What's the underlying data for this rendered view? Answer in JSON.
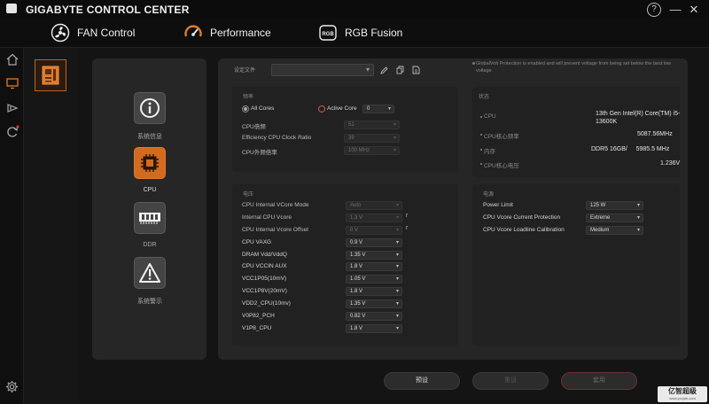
{
  "app": {
    "title": "GIGABYTE CONTROL CENTER",
    "help": "?",
    "minimize": "—",
    "close": "✕"
  },
  "nav": [
    {
      "label": "FAN Control",
      "icon": "fan-icon"
    },
    {
      "label": "Performance",
      "icon": "performance-gauge-icon",
      "active": true
    },
    {
      "label": "RGB Fusion",
      "icon": "rgb-fusion-icon"
    }
  ],
  "categories": [
    {
      "label": "系统信息",
      "icon": "info-icon"
    },
    {
      "label": "CPU",
      "icon": "cpu-chip-icon",
      "active": true
    },
    {
      "label": "DDR",
      "icon": "memory-icon"
    },
    {
      "label": "系统警示",
      "icon": "warning-icon"
    }
  ],
  "profile": {
    "label": "设定文件",
    "value": ""
  },
  "notice": "GlobalVolt Protection is enabled and will prevent voltage from being set below the best low voltage",
  "freq": {
    "title": "频率",
    "all_cores": "All Cores",
    "active_core": "Active Core",
    "active_core_value": "0",
    "rows": [
      {
        "label": "CPU倍频",
        "value": "51"
      },
      {
        "label": "Efficiency CPU Clock Ratio",
        "value": "39"
      },
      {
        "label": "CPU外频倍率",
        "value": "100 MHz"
      }
    ]
  },
  "status": {
    "title": "状态",
    "rows": [
      {
        "label": "CPU",
        "value": "13th Gen Intel(R) Core(TM) i5-13600K"
      },
      {
        "label": "CPU核心频率",
        "value": "5087.56MHz"
      },
      {
        "label": "内存",
        "value": "DDR5 16GB/     5985.5 MHz"
      },
      {
        "label": "CPU核心电压",
        "value": "1.236V"
      }
    ]
  },
  "voltage": {
    "title": "电压",
    "rows": [
      {
        "label": "CPU Internal VCore Mode",
        "value": "Auto",
        "disabled": true
      },
      {
        "label": "Internal CPU Vcore",
        "value": "1.3 V",
        "disabled": true,
        "trail": "r"
      },
      {
        "label": "CPU Internal Vcore Offset",
        "value": "0 V",
        "disabled": true,
        "trail": "r"
      },
      {
        "label": "CPU VAXG",
        "value": "0.9 V"
      },
      {
        "label": "DRAM Vdd/VddQ",
        "value": "1.35 V"
      },
      {
        "label": "CPU VCCIN AUX",
        "value": "1.8 V"
      },
      {
        "label": "VCC1P05(10mV)",
        "value": "1.05 V"
      },
      {
        "label": "VCC1P8V(20mV)",
        "value": "1.8 V"
      },
      {
        "label": "VDD2_CPU(10mv)",
        "value": "1.35 V"
      },
      {
        "label": "V0P82_PCH",
        "value": "0.82 V"
      },
      {
        "label": "V1P8_CPU",
        "value": "1.8 V"
      }
    ]
  },
  "power": {
    "title": "电源",
    "rows": [
      {
        "label": "Power Limit",
        "value": "125 W"
      },
      {
        "label": "CPU Vcore Current Protection",
        "value": "Extreme"
      },
      {
        "label": "CPU Vcore Loadline Calibration",
        "value": "Medium"
      }
    ]
  },
  "buttons": {
    "default": "预设",
    "reset": "重设",
    "apply": "套用"
  },
  "watermark": {
    "text": "亿智超级",
    "sub": "www.yzcjdb.com"
  },
  "colors": {
    "accent": "#d26a1f",
    "panel": "#262626",
    "background": "#141414"
  }
}
